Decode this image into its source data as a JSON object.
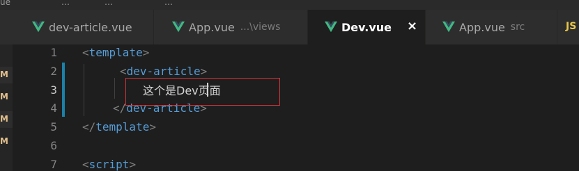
{
  "top_strip": {
    "fragments": [
      "ue",
      "…",
      "…",
      "…"
    ]
  },
  "tabs": [
    {
      "icon": "vue-icon",
      "label": "dev-article.vue",
      "description": "",
      "active": false
    },
    {
      "icon": "vue-icon",
      "label": "App.vue",
      "description": "...\\views",
      "active": false
    },
    {
      "icon": "vue-icon",
      "label": "Dev.vue",
      "description": "",
      "active": true,
      "close": "×"
    },
    {
      "icon": "vue-icon",
      "label": "App.vue",
      "description": "src",
      "active": false
    },
    {
      "icon": "js-icon",
      "label": "JS",
      "description": "",
      "active": false
    }
  ],
  "git_markers": [
    "M",
    "M",
    "M",
    "M"
  ],
  "editor": {
    "line_numbers": [
      "1",
      "2",
      "3",
      "4",
      "5",
      "6",
      "7"
    ],
    "current_line": 3,
    "lines": {
      "l1": {
        "open": "<",
        "tag": "template",
        "close": ">"
      },
      "l2": {
        "open": "<",
        "tag": "dev-article",
        "close": ">"
      },
      "l3": {
        "text": "这个是Dev页面"
      },
      "l4": {
        "open": "</",
        "tag": "dev-article",
        "close": ">"
      },
      "l5": {
        "open": "</",
        "tag": "template",
        "close": ">"
      },
      "l7": {
        "open": "<",
        "tag": "script",
        "close": ">"
      }
    }
  },
  "colors": {
    "vue_green": "#41b883",
    "tag_blue": "#569cd6",
    "modified_gold": "#e2c08d",
    "highlight_red": "#d0343b",
    "git_bar_blue": "#1b81a8"
  }
}
